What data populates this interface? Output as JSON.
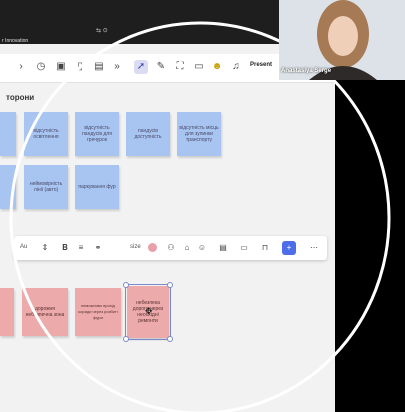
{
  "window": {
    "title_fragment": "r Innovation",
    "status_icons": "⇆ ⊙"
  },
  "toolbar": {
    "left_chevron": "›",
    "present_label": "Present",
    "icons": [
      "timer-icon",
      "comment-icon",
      "doc-icon",
      "board-icon",
      "more-icon",
      "pointer-icon",
      "pen-icon",
      "frame-icon",
      "note-icon",
      "avatar-icon",
      "bell-icon"
    ]
  },
  "canvas": {
    "header": "торони"
  },
  "notes_blue": [
    {
      "text": ""
    },
    {
      "text": "відсутність освітлення"
    },
    {
      "text": "відсутність пандусів для гречурок"
    },
    {
      "text": "пандусів доступність"
    },
    {
      "text": "відсутність місць для зупинки транспорту"
    },
    {
      "text": ""
    },
    {
      "text": "неймовірність лінії (авто)"
    },
    {
      "text": "паркування фур"
    }
  ],
  "context_bar": {
    "font_label": "Au",
    "size_label": "size"
  },
  "notes_pink": [
    {
      "text": ""
    },
    {
      "text": "дорожня небезпечна зона"
    },
    {
      "text": "неможливо прохід кориди через розбиті фури"
    },
    {
      "text": "небезпека дороги через необхідні ремонти"
    }
  ],
  "camera": {
    "name": "Anastasiya Serge"
  }
}
